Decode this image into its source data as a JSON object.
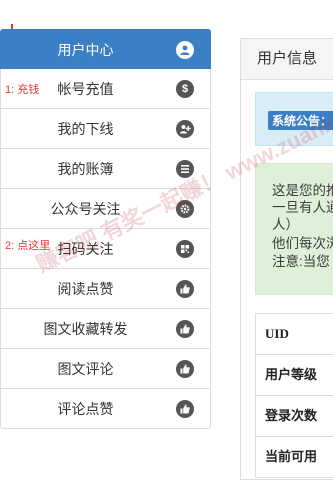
{
  "sidebar": {
    "items": [
      {
        "label": "用户中心",
        "icon": "user-icon",
        "active": true
      },
      {
        "label": "帐号充值",
        "icon": "dollar-icon",
        "active": false
      },
      {
        "label": "我的下线",
        "icon": "user-add-icon",
        "active": false
      },
      {
        "label": "我的账簿",
        "icon": "list-icon",
        "active": false
      },
      {
        "label": "公众号关注",
        "icon": "gear-icon",
        "active": false
      },
      {
        "label": "扫码关注",
        "icon": "qrcode-icon",
        "active": false
      },
      {
        "label": "阅读点赞",
        "icon": "thumbs-up-icon",
        "active": false
      },
      {
        "label": "图文收藏转发",
        "icon": "thumbs-up-icon",
        "active": false
      },
      {
        "label": "图文评论",
        "icon": "thumbs-up-icon",
        "active": false
      },
      {
        "label": "评论点赞",
        "icon": "thumbs-up-icon",
        "active": false
      }
    ]
  },
  "annotations": {
    "recharge": "1: 充钱",
    "click_here": "2: 点这里"
  },
  "panel": {
    "title": "用户信息",
    "notice_badge": "系统公告：",
    "tip_lines": [
      "这是您的推",
      "一旦有人通",
      "人）",
      "他们每次浏",
      "注意:当您"
    ],
    "table_rows": [
      "UID",
      "用户等级",
      "登录次数",
      "当前可用"
    ]
  },
  "watermark": "赚客吧 有奖一起赚！ www.zuanke8.com",
  "colors": {
    "accent": "#3b7fc4",
    "annotation": "#e53935",
    "notice_bg": "#d9edf7",
    "tip_bg": "#dff0d8"
  }
}
